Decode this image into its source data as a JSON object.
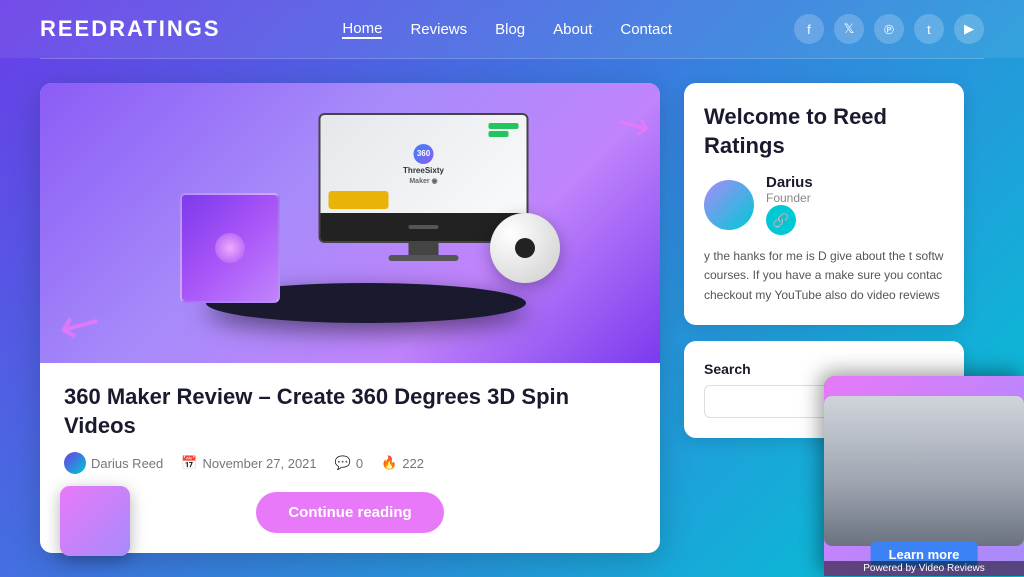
{
  "header": {
    "logo": "ReedRatings",
    "nav": {
      "items": [
        {
          "label": "Home",
          "active": true
        },
        {
          "label": "Reviews",
          "active": false
        },
        {
          "label": "Blog",
          "active": false
        },
        {
          "label": "About",
          "active": false
        },
        {
          "label": "Contact",
          "active": false
        }
      ]
    },
    "social": [
      "f",
      "t",
      "p",
      "T",
      "yt"
    ]
  },
  "article": {
    "title": "360 Maker Review – Create 360 Degrees 3D Spin Videos",
    "meta": {
      "author": "Darius Reed",
      "date": "November 27, 2021",
      "comments": "0",
      "views": "222"
    },
    "continue_btn": "Continue reading"
  },
  "sidebar": {
    "welcome_title": "Welcome to Reed Ratings",
    "author": {
      "name": "Darius",
      "role": "Founder"
    },
    "description": "y the  hanks for me is D give about the t softw courses. If you have a make sure you contac checkout my YouTube also do video reviews",
    "search_label": "Search",
    "search_placeholder": ""
  },
  "video_popup": {
    "learn_btn": "Learn more",
    "powered": "Powered by Video Reviews"
  }
}
